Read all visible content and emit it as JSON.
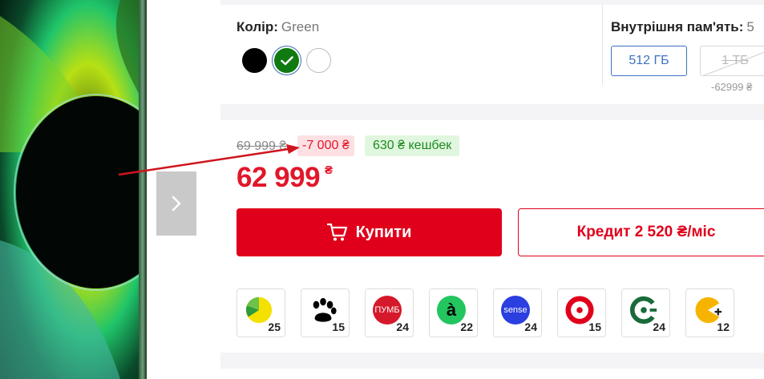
{
  "gallery": {
    "next_icon": "chevron-right-icon"
  },
  "color": {
    "label": "Колір:",
    "value": "Green",
    "swatches": [
      {
        "name": "black",
        "hex": "#000000"
      },
      {
        "name": "green",
        "hex": "#0f7a0f",
        "selected": true
      },
      {
        "name": "white",
        "hex": "#ffffff"
      }
    ]
  },
  "memory": {
    "label": "Внутрішня пам'ять:",
    "value": "5",
    "options": [
      {
        "label": "512 ГБ",
        "selected": true
      },
      {
        "label": "1 ТБ",
        "available": false
      }
    ],
    "alt_price": "-62999 ₴"
  },
  "pricing": {
    "old_price": "69 999 ₴",
    "discount": "-7 000 ₴",
    "cashback": "630 ₴ кешбек",
    "price": "62 999",
    "currency": "₴"
  },
  "actions": {
    "buy_label": "Купити",
    "credit_label": "Кредит 2 520 ₴/міс"
  },
  "installments": [
    {
      "icon": "pie-chart-icon",
      "months": "25"
    },
    {
      "icon": "paw-icon",
      "months": "15"
    },
    {
      "icon": "pumb-icon",
      "logo_text": "ПУМБ",
      "months": "24"
    },
    {
      "icon": "a-bank-icon",
      "logo_text": "à",
      "months": "22"
    },
    {
      "icon": "sense-icon",
      "logo_text": "sense",
      "months": "24"
    },
    {
      "icon": "target-icon",
      "months": "15"
    },
    {
      "icon": "oschadbank-icon",
      "months": "24"
    },
    {
      "icon": "pacman-plus-icon",
      "months": "12"
    }
  ],
  "colors": {
    "accent_red": "#e0001b",
    "link_blue": "#3d72c2",
    "cashback_green": "#1a8c1f"
  }
}
